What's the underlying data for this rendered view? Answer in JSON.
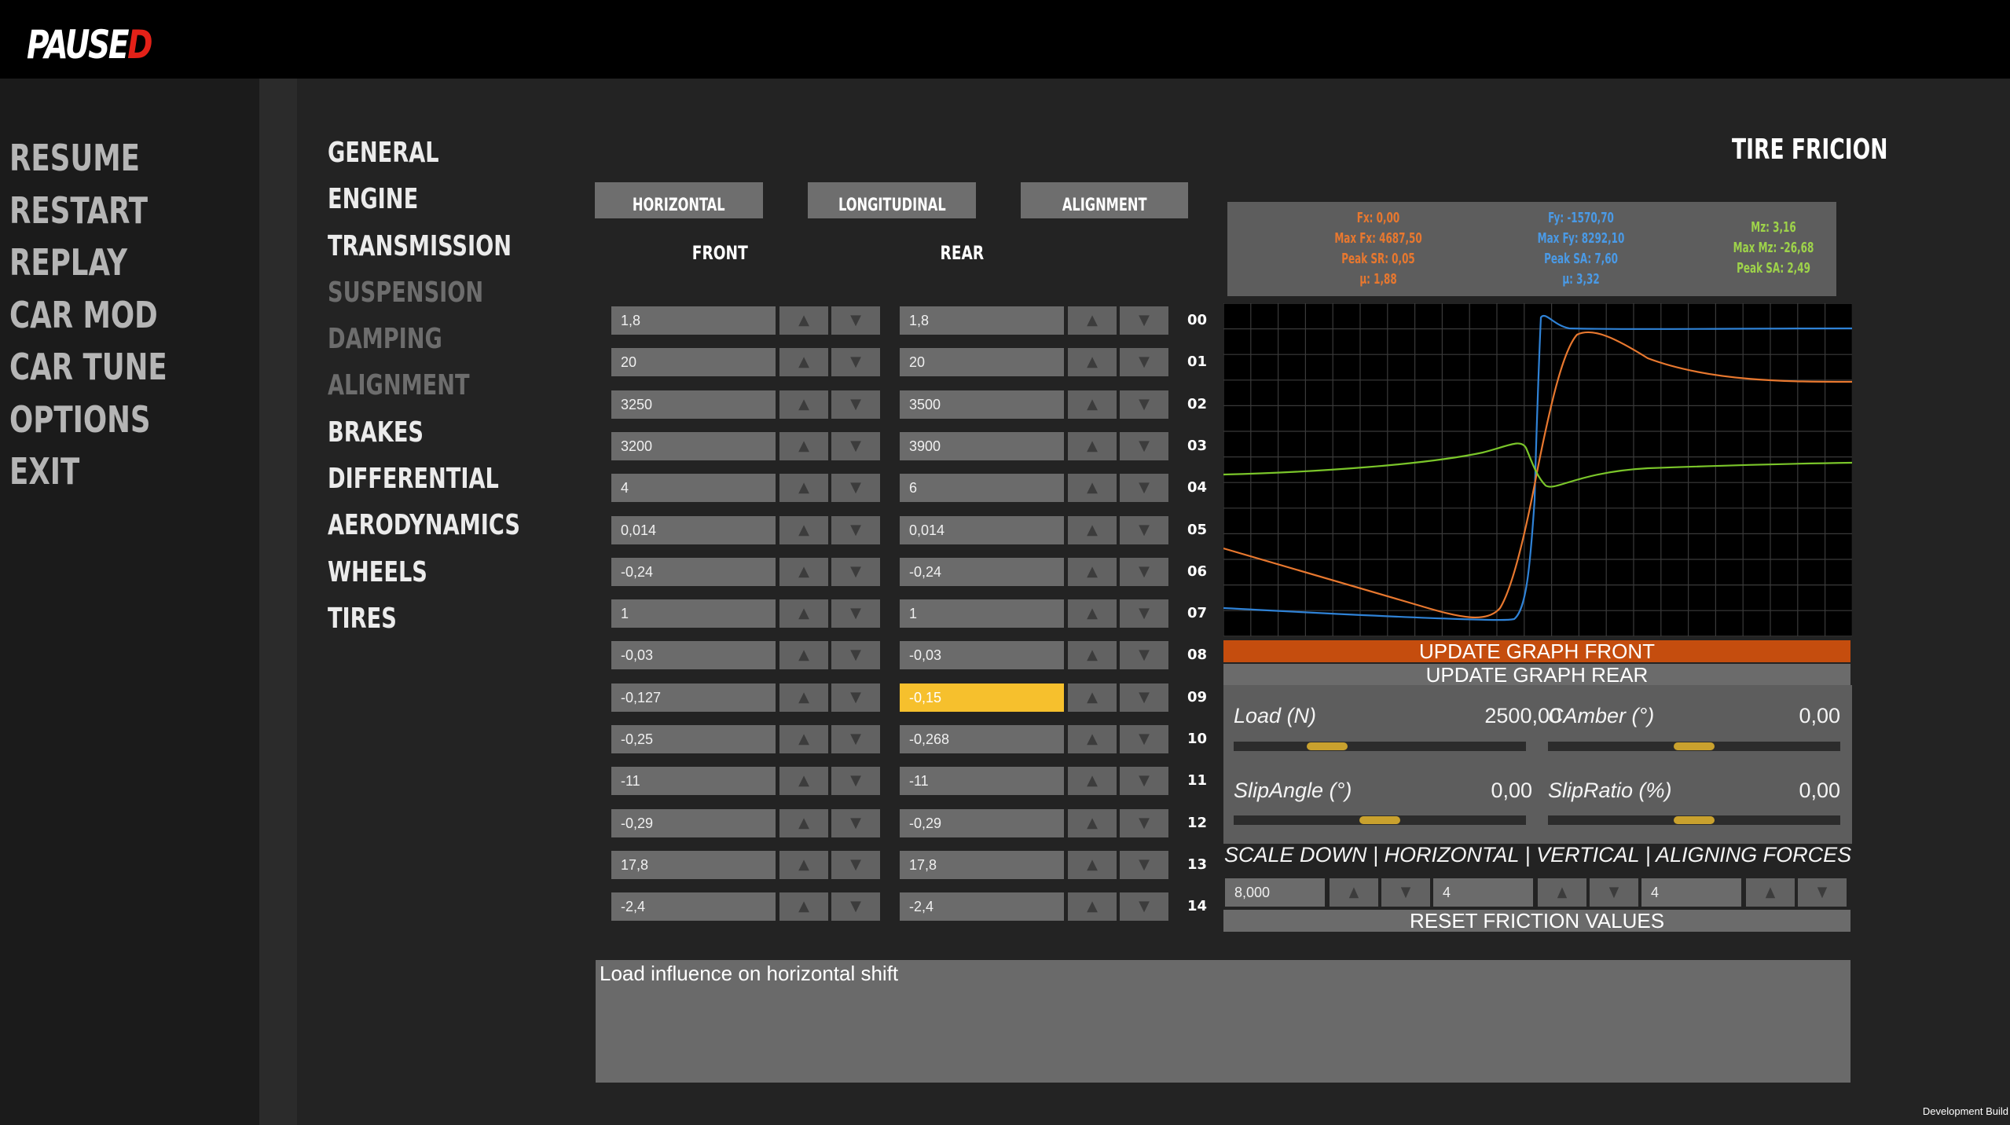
{
  "title": {
    "text_main": "PAUSE",
    "text_accent": "D"
  },
  "main_menu": [
    {
      "label": "RESUME"
    },
    {
      "label": "RESTART"
    },
    {
      "label": "REPLAY"
    },
    {
      "label": "CAR MOD"
    },
    {
      "label": "CAR TUNE"
    },
    {
      "label": "OPTIONS"
    },
    {
      "label": "EXIT"
    }
  ],
  "sub_menu": [
    {
      "label": "GENERAL",
      "enabled": true
    },
    {
      "label": "ENGINE",
      "enabled": true
    },
    {
      "label": "TRANSMISSION",
      "enabled": true
    },
    {
      "label": "SUSPENSION",
      "enabled": false
    },
    {
      "label": "DAMPING",
      "enabled": false
    },
    {
      "label": "ALIGNMENT",
      "enabled": false
    },
    {
      "label": "BRAKES",
      "enabled": true
    },
    {
      "label": "DIFFERENTIAL",
      "enabled": true
    },
    {
      "label": "AERODYNAMICS",
      "enabled": true
    },
    {
      "label": "WHEELS",
      "enabled": true
    },
    {
      "label": "TIRES",
      "enabled": true
    }
  ],
  "tabs": {
    "horizontal": "HORIZONTAL",
    "longitudinal": "LONGITUDINAL",
    "alignment": "ALIGNMENT"
  },
  "columns": {
    "front": "FRONT",
    "rear": "REAR"
  },
  "step_icons": {
    "up": "▲",
    "down": "▼"
  },
  "rows": [
    {
      "index": "00",
      "front": "1,8",
      "rear": "1,8"
    },
    {
      "index": "01",
      "front": "20",
      "rear": "20"
    },
    {
      "index": "02",
      "front": "3250",
      "rear": "3500"
    },
    {
      "index": "03",
      "front": "3200",
      "rear": "3900"
    },
    {
      "index": "04",
      "front": "4",
      "rear": "6"
    },
    {
      "index": "05",
      "front": "0,014",
      "rear": "0,014"
    },
    {
      "index": "06",
      "front": "-0,24",
      "rear": "-0,24"
    },
    {
      "index": "07",
      "front": "1",
      "rear": "1"
    },
    {
      "index": "08",
      "front": "-0,03",
      "rear": "-0,03"
    },
    {
      "index": "09",
      "front": "-0,127",
      "rear": "-0,15",
      "rear_highlight": true
    },
    {
      "index": "10",
      "front": "-0,25",
      "rear": "-0,268"
    },
    {
      "index": "11",
      "front": "-11",
      "rear": "-11"
    },
    {
      "index": "12",
      "front": "-0,29",
      "rear": "-0,29"
    },
    {
      "index": "13",
      "front": "17,8",
      "rear": "17,8"
    },
    {
      "index": "14",
      "front": "-2,4",
      "rear": "-2,4"
    }
  ],
  "tire_friction": {
    "title": "TIRE FRICION",
    "stats": {
      "fx": {
        "lines": [
          "Fx: 0,00",
          "Max Fx: 4687,50",
          "Peak SR: 0,05",
          "μ: 1,88"
        ],
        "color": "#e8782f"
      },
      "fy": {
        "lines": [
          "Fy: -1570,70",
          "Max Fy: 8292,10",
          "Peak SA: 7,60",
          "μ: 3,32"
        ],
        "color": "#4a9ae6"
      },
      "mz": {
        "lines": [
          "Mz: 3,16",
          "Max Mz: -26,68",
          "Peak SA: 2,49"
        ],
        "color": "#9ed34a"
      }
    },
    "update_front": "UPDATE GRAPH FRONT",
    "update_rear": "UPDATE GRAPH REAR",
    "params": {
      "load": {
        "label": "Load (N)",
        "value": "2500,00",
        "level": 0.29
      },
      "camber": {
        "label": "CAmber (°)",
        "value": "0,00",
        "level": 0.5
      },
      "slip_angle": {
        "label": "SlipAngle (°)",
        "value": "0,00",
        "level": 0.5
      },
      "slip_ratio": {
        "label": "SlipRatio (%)",
        "value": "0,00",
        "level": 0.5
      }
    },
    "scale_label": "SCALE DOWN | HORIZONTAL | VERTICAL | ALIGNING FORCES",
    "scale_values": {
      "horizontal": "8,000",
      "vertical": "4",
      "aligning": "4"
    },
    "reset_label": "RESET FRICTION VALUES"
  },
  "description": "Load influence on horizontal shift",
  "dev_build": "Development Build",
  "colors": {
    "accent_orange": "#c54d0e",
    "highlight_yellow": "#f6c02d",
    "logo_red": "#e32118"
  }
}
